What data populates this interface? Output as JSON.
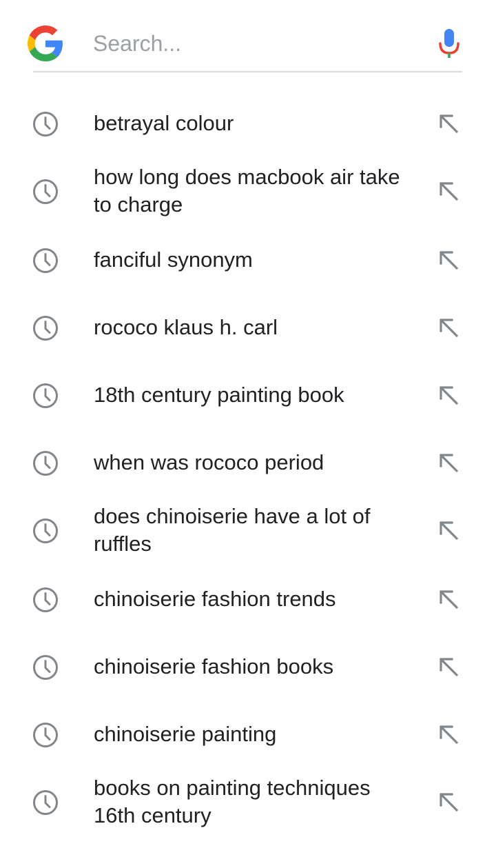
{
  "search": {
    "placeholder": "Search...",
    "value": "",
    "logo_icon": "google-g-logo",
    "mic_icon": "microphone-icon"
  },
  "colors": {
    "google_blue": "#4285F4",
    "google_red": "#EA4335",
    "google_yellow": "#FBBC05",
    "google_green": "#34A853",
    "text": "#202124",
    "placeholder": "#9aa0a6",
    "icon_gray": "#80868b",
    "divider": "#dadce0"
  },
  "suggestions": [
    {
      "text": "betrayal colour",
      "lead_icon": "history-icon",
      "trail_icon": "arrow-up-left-icon"
    },
    {
      "text": "how long does macbook air take to charge",
      "lead_icon": "history-icon",
      "trail_icon": "arrow-up-left-icon"
    },
    {
      "text": "fanciful synonym",
      "lead_icon": "history-icon",
      "trail_icon": "arrow-up-left-icon"
    },
    {
      "text": "rococo klaus h. carl",
      "lead_icon": "history-icon",
      "trail_icon": "arrow-up-left-icon"
    },
    {
      "text": "18th century painting book",
      "lead_icon": "history-icon",
      "trail_icon": "arrow-up-left-icon"
    },
    {
      "text": "when was rococo period",
      "lead_icon": "history-icon",
      "trail_icon": "arrow-up-left-icon"
    },
    {
      "text": "does chinoiserie have a lot of ruffles",
      "lead_icon": "history-icon",
      "trail_icon": "arrow-up-left-icon"
    },
    {
      "text": "chinoiserie fashion trends",
      "lead_icon": "history-icon",
      "trail_icon": "arrow-up-left-icon"
    },
    {
      "text": "chinoiserie fashion books",
      "lead_icon": "history-icon",
      "trail_icon": "arrow-up-left-icon"
    },
    {
      "text": "chinoiserie painting",
      "lead_icon": "history-icon",
      "trail_icon": "arrow-up-left-icon"
    },
    {
      "text": "books on painting techniques 16th century",
      "lead_icon": "history-icon",
      "trail_icon": "arrow-up-left-icon"
    }
  ]
}
